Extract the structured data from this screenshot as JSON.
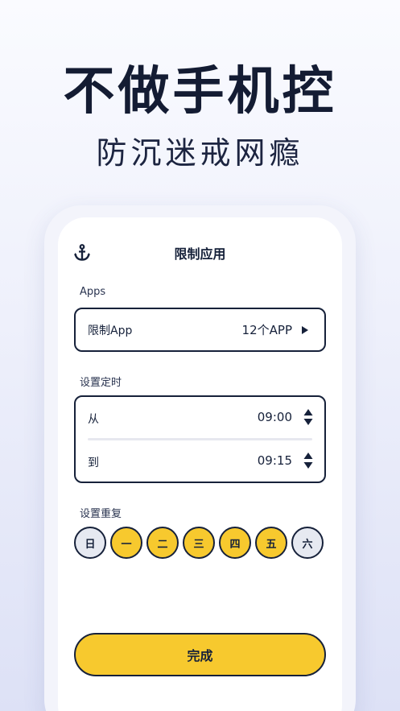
{
  "promo": {
    "headline": "不做手机控",
    "subline": "防沉迷戒网瘾"
  },
  "screen": {
    "title": "限制应用",
    "top_icon": "anchor-icon",
    "apps_section": {
      "label": "Apps",
      "row_label": "限制App",
      "row_value": "12个APP",
      "arrow_icon": "play-icon"
    },
    "time_section": {
      "label": "设置定时",
      "from_label": "从",
      "from_value": "09:00",
      "to_label": "到",
      "to_value": "09:15",
      "stepper_icon": "up-down-stepper-icon"
    },
    "repeat_section": {
      "label": "设置重复",
      "days": [
        {
          "label": "日",
          "selected": false
        },
        {
          "label": "一",
          "selected": true
        },
        {
          "label": "二",
          "selected": true
        },
        {
          "label": "三",
          "selected": true
        },
        {
          "label": "四",
          "selected": true
        },
        {
          "label": "五",
          "selected": true
        },
        {
          "label": "六",
          "selected": false
        }
      ]
    },
    "done_label": "完成"
  },
  "colors": {
    "accent_yellow": "#f7c92e",
    "ink": "#16213a",
    "day_off": "#e6e9f1"
  }
}
